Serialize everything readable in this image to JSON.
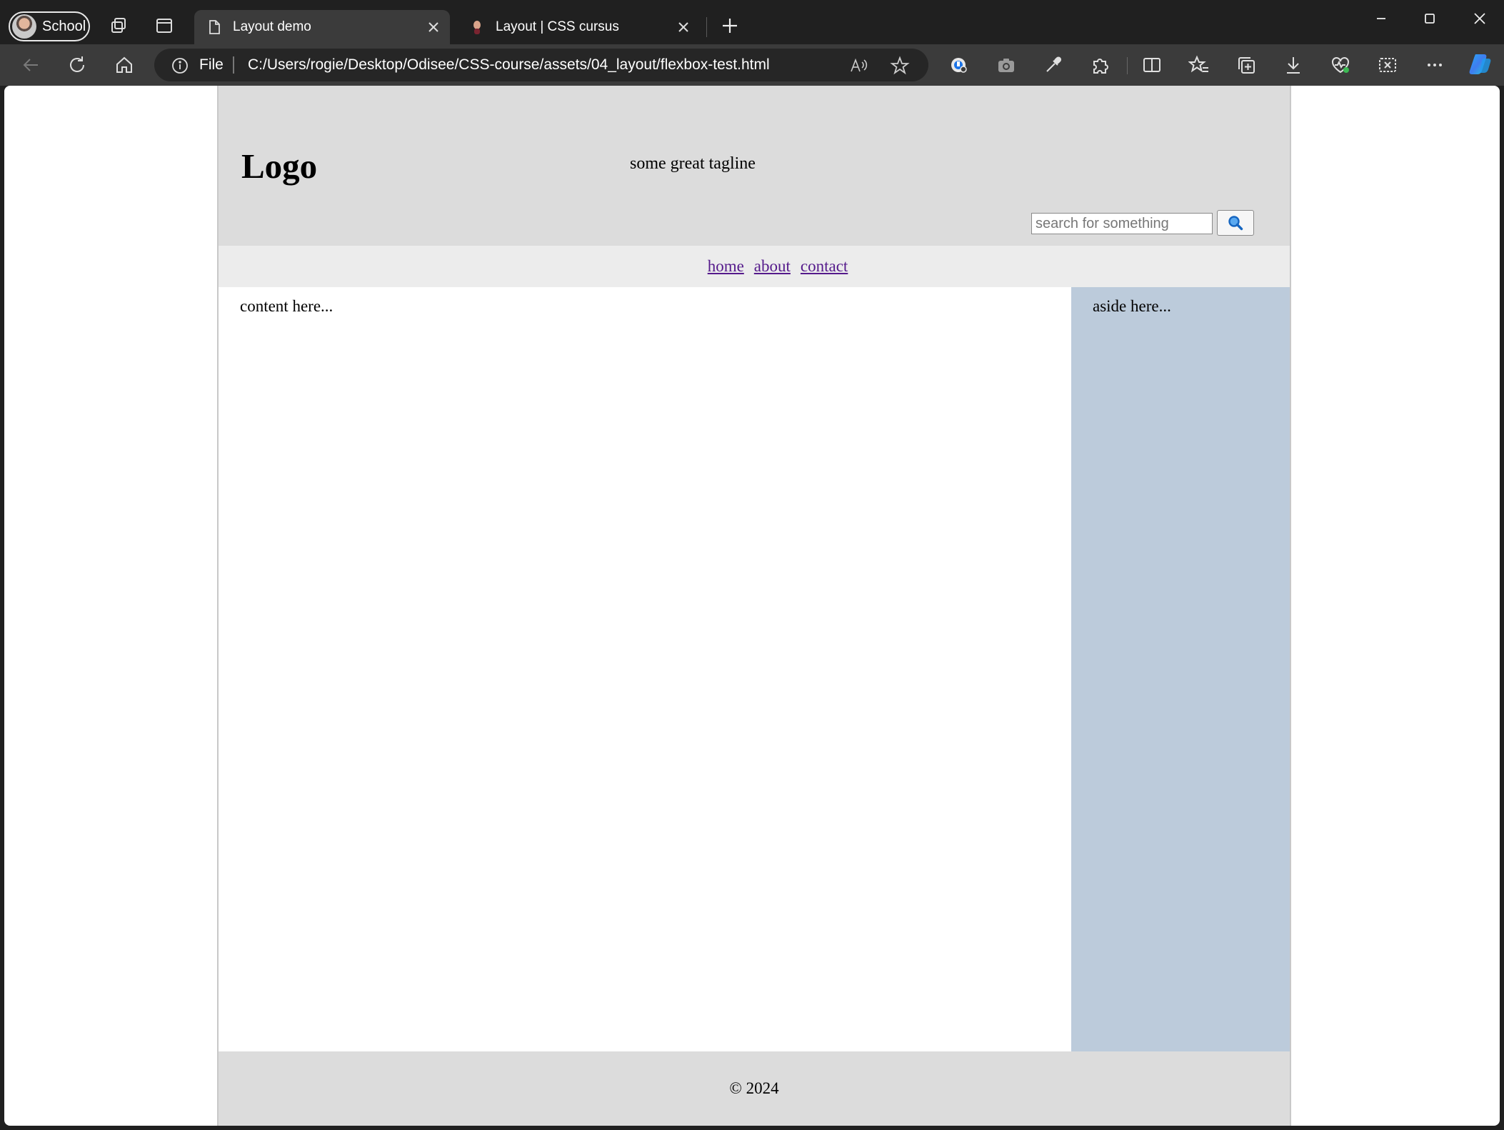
{
  "browser": {
    "profile_label": "School",
    "tabs": [
      {
        "title": "Layout demo",
        "active": true
      },
      {
        "title": "Layout | CSS cursus",
        "active": false
      }
    ],
    "address": {
      "scheme_label": "File",
      "url": "C:/Users/rogie/Desktop/Odisee/CSS-course/assets/04_layout/flexbox-test.html"
    },
    "accent_color": "#1a73e8"
  },
  "page": {
    "header": {
      "logo": "Logo",
      "tagline": "some great tagline",
      "search_placeholder": "search for something"
    },
    "nav": {
      "links": [
        "home",
        "about",
        "contact"
      ]
    },
    "main": {
      "content_text": "content here...",
      "aside_text": "aside here..."
    },
    "footer": {
      "text": "© 2024"
    },
    "colors": {
      "header_bg": "#dcdcdc",
      "nav_bg": "#ececec",
      "aside_bg": "#bccbdb",
      "link": "#551a8b"
    }
  }
}
